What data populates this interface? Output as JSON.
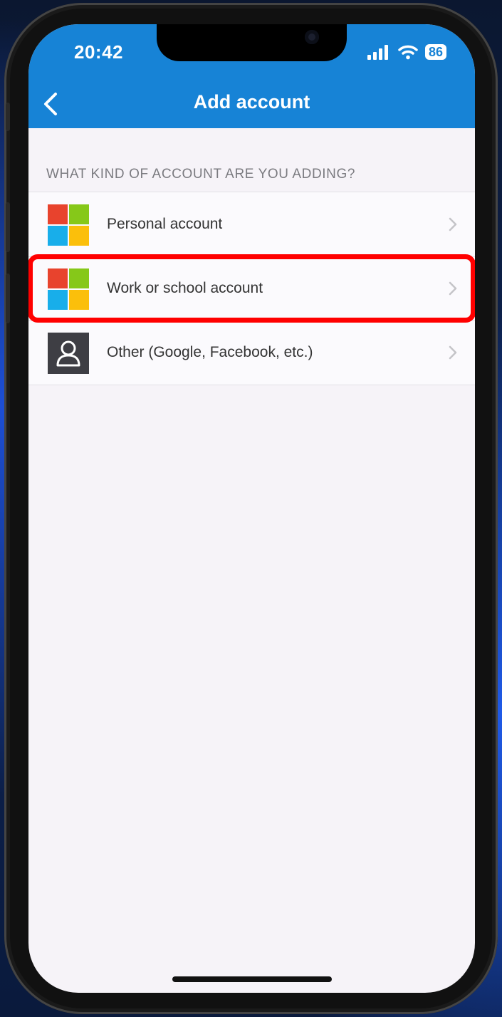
{
  "status_bar": {
    "time": "20:42",
    "battery": "86",
    "signal_icon": "cellular-signal-icon",
    "wifi_icon": "wifi-icon"
  },
  "header": {
    "title": "Add account",
    "back_icon": "chevron-left-icon",
    "color": "#1783d6"
  },
  "section": {
    "header": "WHAT KIND OF ACCOUNT ARE YOU ADDING?"
  },
  "accounts": [
    {
      "label": "Personal account",
      "icon": "microsoft-logo-icon"
    },
    {
      "label": "Work or school account",
      "icon": "microsoft-logo-icon",
      "highlighted": true
    },
    {
      "label": "Other (Google, Facebook, etc.)",
      "icon": "person-icon"
    }
  ],
  "colors": {
    "highlight": "#ff0000",
    "ms_red": "#e8432d",
    "ms_green": "#86c819",
    "ms_blue": "#18aeea",
    "ms_yellow": "#fbbf0b"
  }
}
